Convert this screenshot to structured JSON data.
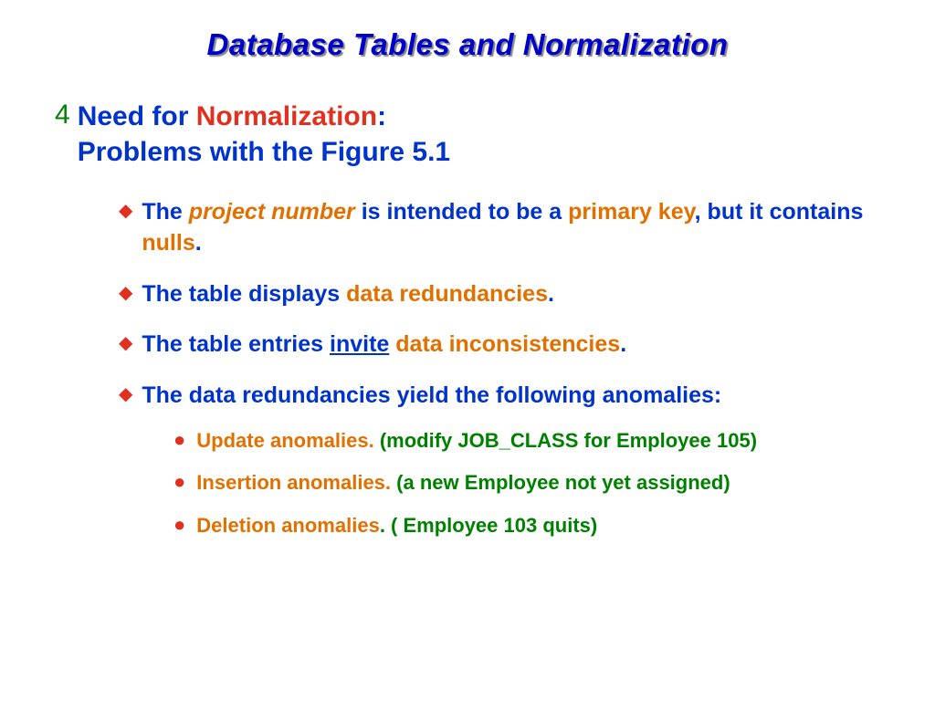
{
  "title": "Database Tables and Normalization",
  "level1": {
    "bullet": "4",
    "line1a": "Need for ",
    "line1b": "Normalization",
    "line1c": ":",
    "line2": "Problems with the Figure 5.1"
  },
  "bullets2": [
    {
      "parts": [
        {
          "cls": "blue",
          "txt": "The "
        },
        {
          "cls": "orange italic",
          "txt": "project number "
        },
        {
          "cls": "blue",
          "txt": "is intended to be a "
        },
        {
          "cls": "orange",
          "txt": "primary key"
        },
        {
          "cls": "blue",
          "txt": ", but it contains "
        },
        {
          "cls": "orange",
          "txt": "nulls"
        },
        {
          "cls": "blue",
          "txt": "."
        }
      ]
    },
    {
      "parts": [
        {
          "cls": "blue",
          "txt": "The table displays "
        },
        {
          "cls": "orange",
          "txt": "data redundancies"
        },
        {
          "cls": "blue",
          "txt": "."
        }
      ]
    },
    {
      "parts": [
        {
          "cls": "blue",
          "txt": "The table entries "
        },
        {
          "cls": "blue underline",
          "txt": "invite"
        },
        {
          "cls": "blue",
          "txt": " "
        },
        {
          "cls": "orange",
          "txt": "data inconsistencies"
        },
        {
          "cls": "blue",
          "txt": "."
        }
      ]
    },
    {
      "parts": [
        {
          "cls": "blue",
          "txt": "The data redundancies yield the following  anomalies:"
        }
      ]
    }
  ],
  "bullets3": [
    {
      "parts": [
        {
          "cls": "orange",
          "txt": "Update anomalies. "
        },
        {
          "cls": "green",
          "txt": "(modify JOB_CLASS for Employee 105)"
        }
      ]
    },
    {
      "parts": [
        {
          "cls": "orange",
          "txt": "Insertion anomalies. "
        },
        {
          "cls": "green",
          "txt": "(a new Employee not yet assigned)"
        }
      ]
    },
    {
      "parts": [
        {
          "cls": "orange",
          "txt": "Deletion anomalies"
        },
        {
          "cls": "green",
          "txt": ". ( Employee 103 quits)"
        }
      ]
    }
  ],
  "diamond": "◆",
  "dot": "●"
}
